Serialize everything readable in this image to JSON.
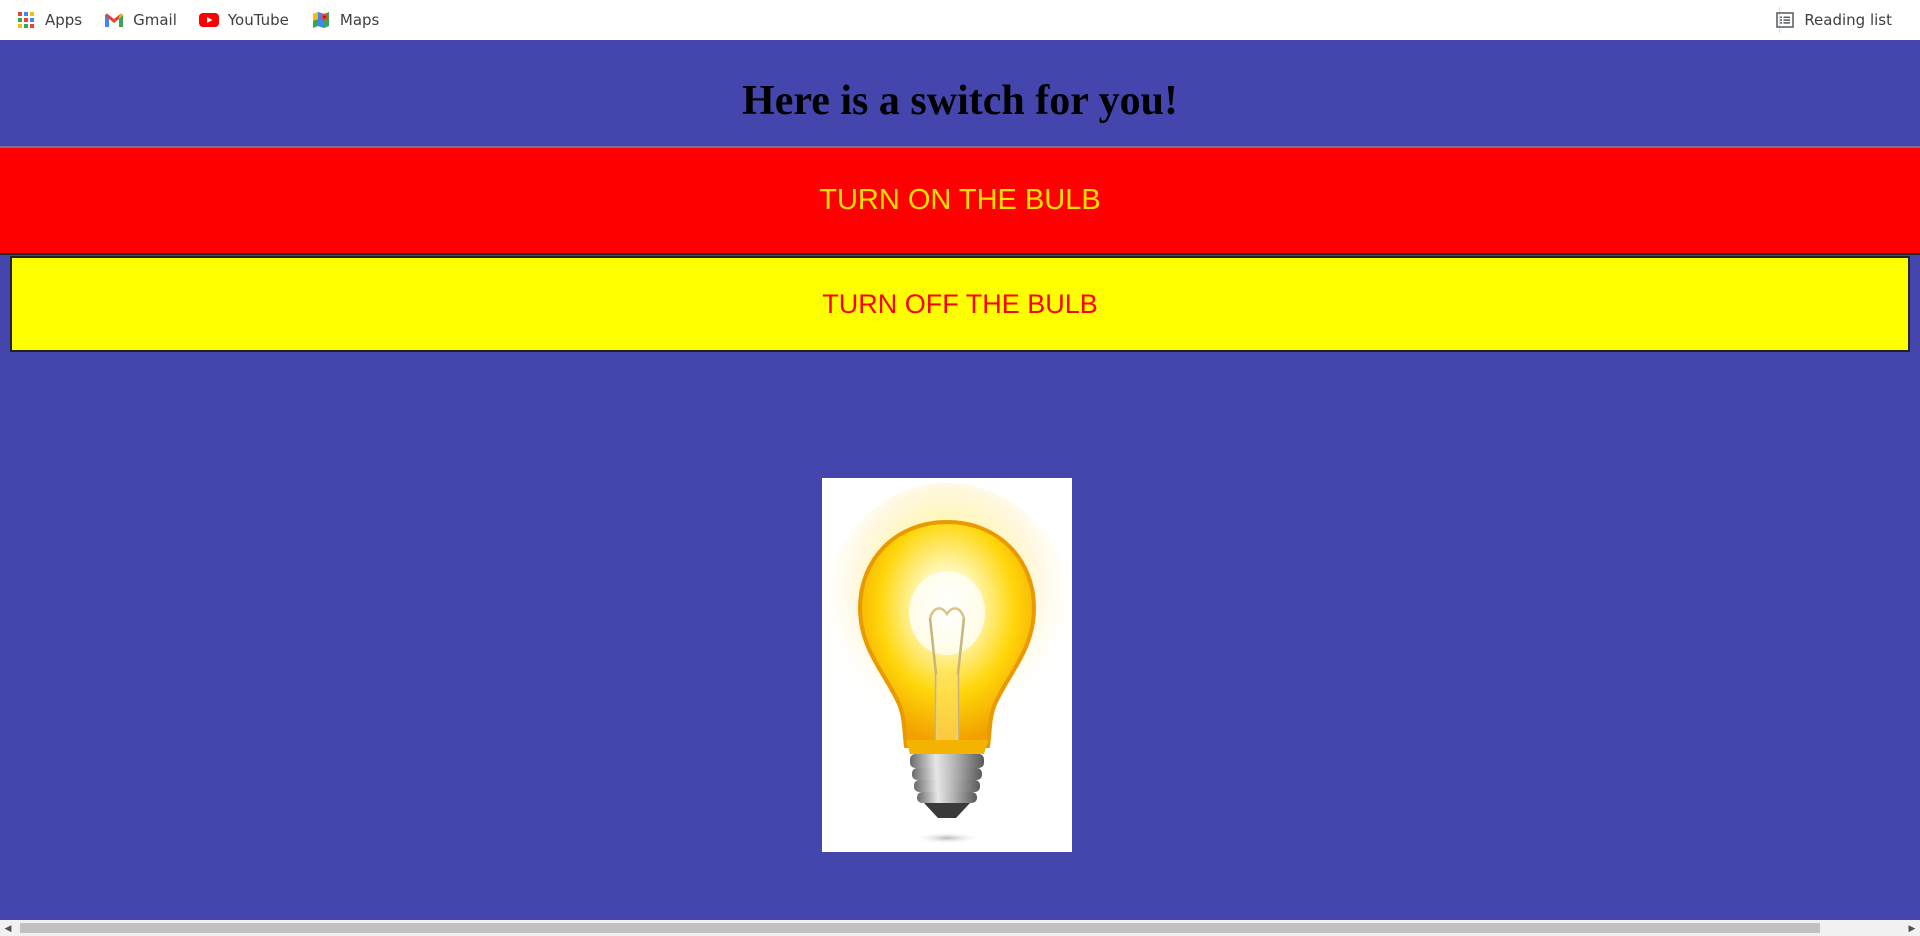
{
  "bookmarks": {
    "items": [
      {
        "label": "Apps",
        "icon": "apps-grid-icon"
      },
      {
        "label": "Gmail",
        "icon": "gmail-icon"
      },
      {
        "label": "YouTube",
        "icon": "youtube-icon"
      },
      {
        "label": "Maps",
        "icon": "maps-icon"
      }
    ],
    "reading_list": {
      "label": "Reading list",
      "icon": "reading-list-icon"
    }
  },
  "page": {
    "title": "Here is a switch for you!",
    "background": "#4446ae",
    "on_button": {
      "label": "TURN ON THE BULB",
      "background": "#ff0000",
      "text_color": "#ffe100"
    },
    "off_button": {
      "label": "TURN OFF THE BULB",
      "background": "#ffff00",
      "text_color": "#ff0000"
    },
    "bulb_state": "on"
  }
}
